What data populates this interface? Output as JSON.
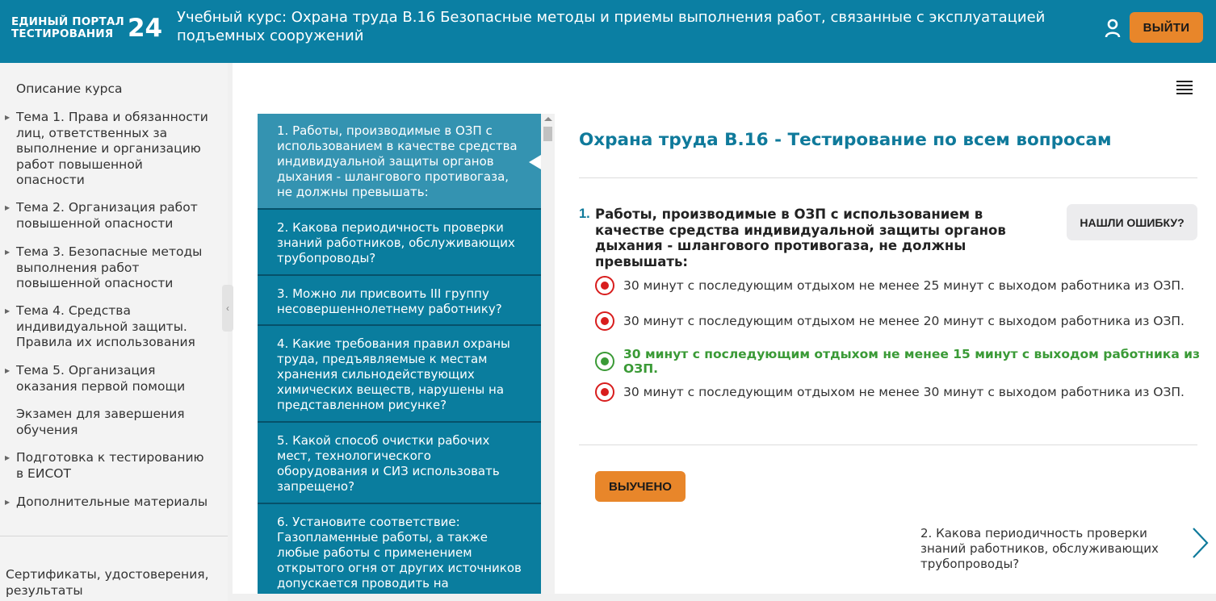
{
  "header": {
    "logo_line1": "ЕДИНЫЙ ПОРТАЛ",
    "logo_line2": "ТЕСТИРОВАНИЯ",
    "logo_number": "24",
    "course_title": "Учебный курс: Охрана труда В.16 Безопасные методы и приемы выполнения работ, связанные с эксплуатацией подъемных сооружений",
    "logout_label": "ВЫЙТИ",
    "user_icon": "user-icon"
  },
  "sidebar": {
    "items": [
      {
        "label": "Описание курса",
        "has_arrow": false
      },
      {
        "label": "Тема 1. Права и обязанности лиц, ответственных за выполнение и организацию работ повышенной опасности",
        "has_arrow": true
      },
      {
        "label": "Тема 2. Организация работ повышенной опасности",
        "has_arrow": true
      },
      {
        "label": "Тема 3. Безопасные методы выполнения работ повышенной опасности",
        "has_arrow": true
      },
      {
        "label": "Тема 4. Средства индивидуальной защиты. Правила их использования",
        "has_arrow": true
      },
      {
        "label": "Тема 5. Организация оказания первой помощи",
        "has_arrow": true
      },
      {
        "label": "Экзамен для завершения обучения",
        "has_arrow": false
      },
      {
        "label": "Подготовка к тестированию в ЕИСОТ",
        "has_arrow": true
      },
      {
        "label": "Дополнительные материалы",
        "has_arrow": true
      }
    ],
    "footer": "Сертификаты, удостоверения, результаты",
    "collapse_icon": "chevron-left-icon"
  },
  "questions": [
    "1. Работы, производимые в ОЗП с использованием в качестве средства индивидуальной защиты органов дыхания - шлангового противогаза, не должны превышать:",
    "2. Какова периодичность проверки знаний работников, обслуживающих трубопроводы?",
    "3. Можно ли присвоить III группу несовершеннолетнему работнику?",
    "4. Какие требования правил охраны труда, предъявляемые к местам хранения сильнодействующих химических веществ, нарушены на представленном рисунке?",
    "5. Какой способ очистки рабочих мест, технологического оборудования и СИЗ использовать запрещено?",
    "6. Установите соответствие: Газопламенные работы, а также любые работы с применением открытого огня от других источников допускается проводить на"
  ],
  "content": {
    "title": "Охрана труда В.16 - Тестирование по всем вопросам",
    "question_number": "1.",
    "question_text": "Работы, производимые в ОЗП с использованием в качестве средства индивидуальной защиты органов дыхания - шлангового противогаза, не должны превышать:",
    "report_label": "НАШЛИ ОШИБКУ?",
    "answers": [
      {
        "text": "30 минут с последующим отдыхом не менее 25 минут с выходом работника из ОЗП.",
        "correct": false
      },
      {
        "text": "30 минут с последующим отдыхом не менее 20 минут с выходом работника из ОЗП.",
        "correct": false
      },
      {
        "text": "30 минут с последующим отдыхом не менее 15 минут с выходом работника из ОЗП.",
        "correct": true
      },
      {
        "text": "30 минут с последующим отдыхом не менее 30 минут с выходом работника из ОЗП.",
        "correct": false
      }
    ],
    "learned_label": "ВЫУЧЕНО",
    "next_question": "2. Какова периодичность проверки знаний работников, обслуживающих трубопроводы?"
  },
  "colors": {
    "header_bg": "#0b7fa3",
    "accent_orange": "#e8862a",
    "list_bg": "#0a7d9e",
    "list_active": "#3493b1",
    "correct_green": "#3a9a36",
    "wrong_red": "#d81d1d",
    "title_blue": "#0f7a9b"
  }
}
